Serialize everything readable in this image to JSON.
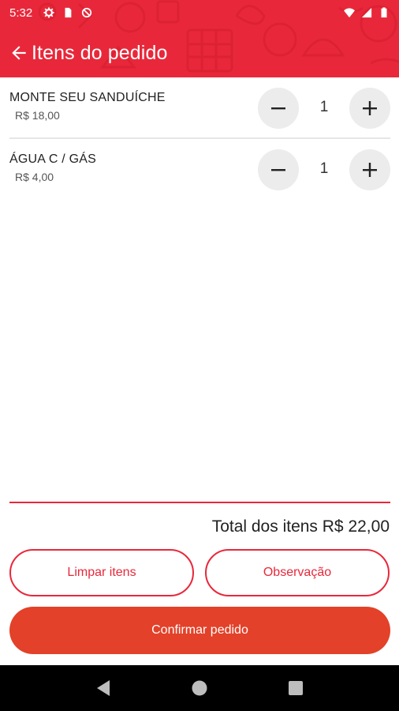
{
  "status_bar": {
    "time": "5:32",
    "icons_left": [
      "gear-icon",
      "sim-card-icon",
      "blocked-icon"
    ],
    "icons_right": [
      "wifi-icon",
      "signal-icon",
      "battery-icon"
    ]
  },
  "toolbar": {
    "title": "Itens do pedido",
    "back_icon": "arrow-left-icon"
  },
  "items": [
    {
      "name": "MONTE SEU SANDUÍCHE",
      "price": "R$ 18,00",
      "quantity": "1"
    },
    {
      "name": "ÁGUA C / GÁS",
      "price": "R$ 4,00",
      "quantity": "1"
    }
  ],
  "footer": {
    "total": "Total dos itens R$ 22,00",
    "clear_label": "Limpar itens",
    "note_label": "Observação",
    "confirm_label": "Confirmar pedido"
  },
  "colors": {
    "primary": "#e8283a",
    "confirm": "#e34129",
    "stepper_bg": "#ececec"
  },
  "nav_bar": {
    "icons": [
      "back-triangle-icon",
      "home-circle-icon",
      "recents-square-icon"
    ]
  }
}
